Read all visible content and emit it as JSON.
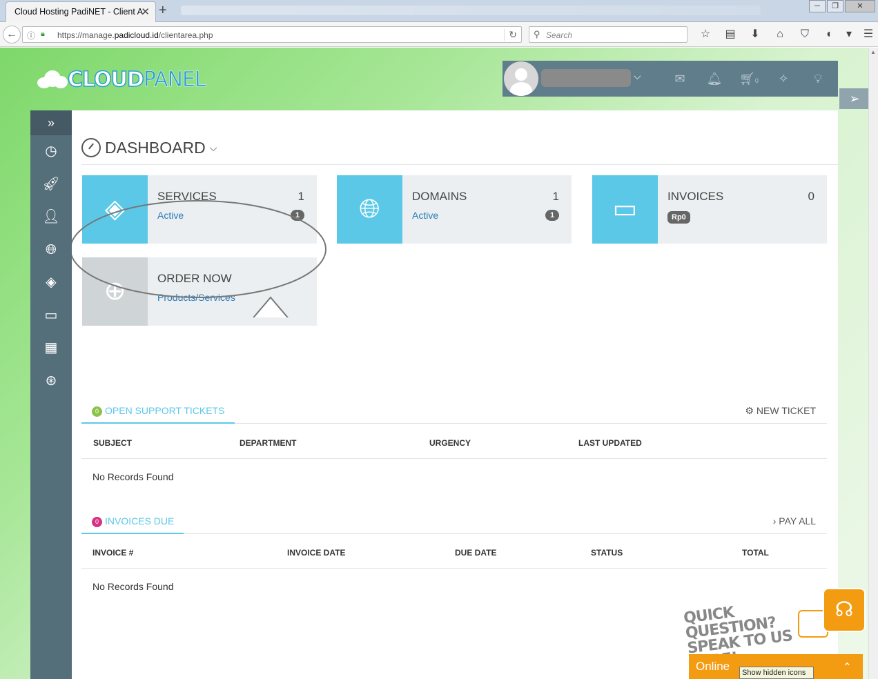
{
  "browser": {
    "tab_title": "Cloud Hosting PadiNET - Client A",
    "tab_close": "✕",
    "new_tab": "+",
    "url_prefix": "https://manage.",
    "url_host": "padicloud.id",
    "url_path": "/clientarea.php",
    "search_placeholder": "Search"
  },
  "header": {
    "logo_part1": "CLOUD",
    "logo_part2": "PANEL",
    "cart_count": "0"
  },
  "dashboard": {
    "title": "DASHBOARD",
    "tiles": [
      {
        "title": "SERVICES",
        "count": "1",
        "link": "Active",
        "badge": "1"
      },
      {
        "title": "DOMAINS",
        "count": "1",
        "link": "Active",
        "badge": "1"
      },
      {
        "title": "INVOICES",
        "count": "0",
        "badge": "Rp0"
      },
      {
        "title": "ORDER NOW",
        "link": "Products/Services"
      }
    ]
  },
  "tickets": {
    "count": "0",
    "title": "OPEN SUPPORT TICKETS",
    "action": "NEW TICKET",
    "columns": [
      "SUBJECT",
      "DEPARTMENT",
      "URGENCY",
      "LAST UPDATED"
    ],
    "empty": "No Records Found",
    "count_color": "#8bc34a"
  },
  "invoices_due": {
    "count": "0",
    "title": "INVOICES DUE",
    "action": "PAY ALL",
    "columns": [
      "INVOICE #",
      "INVOICE DATE",
      "DUE DATE",
      "STATUS",
      "TOTAL"
    ],
    "empty": "No Records Found",
    "count_color": "#d63384"
  },
  "chat": {
    "quick_question": "QUICK QUESTION? SPEAK TO US HERE!",
    "status": "Online"
  },
  "tooltip": "Show hidden icons",
  "colors": {
    "accent": "#5bc8e8",
    "sidebar": "#546e7a",
    "topbar": "#607d8b",
    "chat": "#f39c12"
  }
}
